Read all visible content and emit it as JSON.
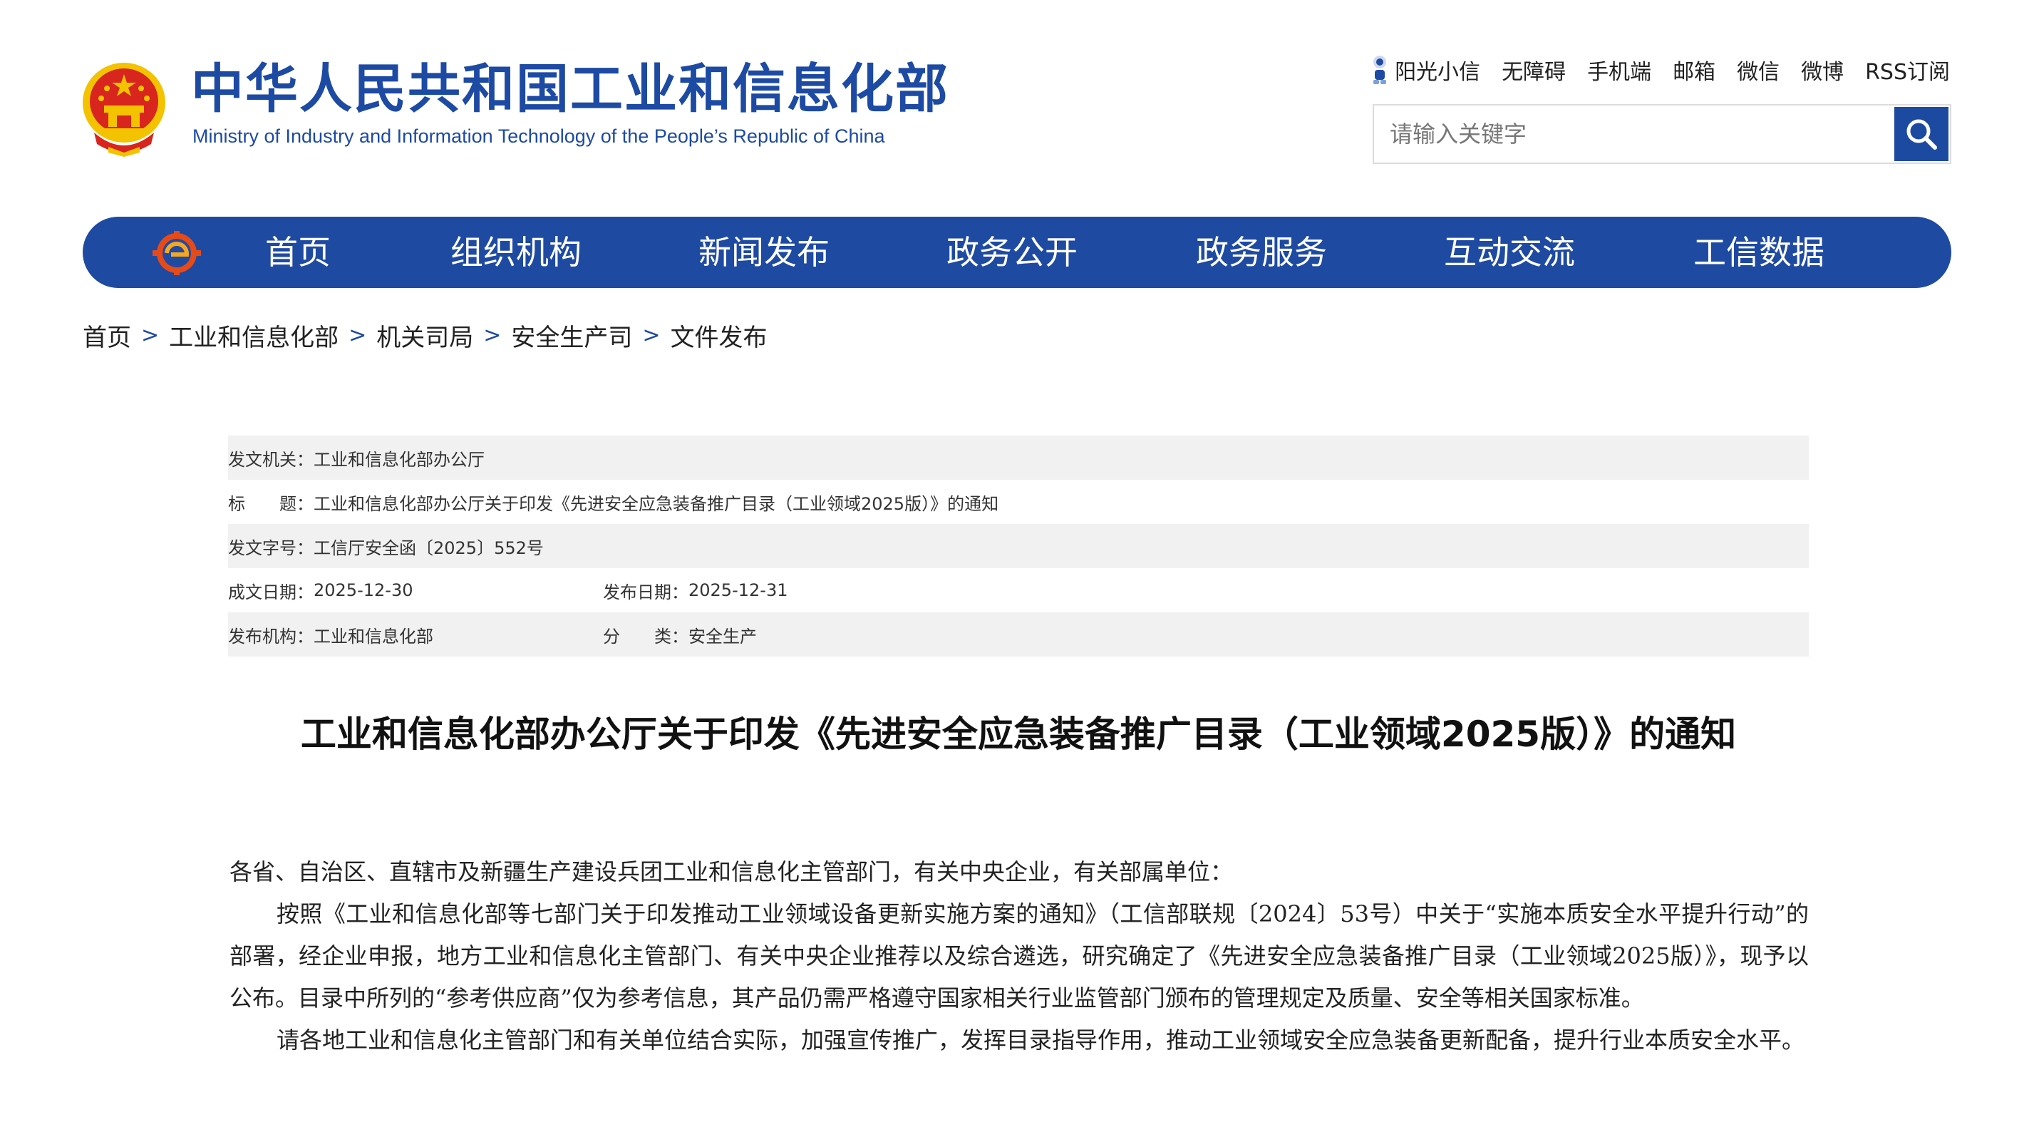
{
  "header": {
    "title": "中华人民共和国工业和信息化部",
    "subtitle": "Ministry of Industry and Information Technology of the People’s Republic of China",
    "top_links": [
      "阳光小信",
      "无障碍",
      "手机端",
      "邮箱",
      "微信",
      "微博",
      "RSS订阅"
    ],
    "search_placeholder": "请输入关键字",
    "colors": {
      "brand_blue": "#1e4aa2",
      "emblem_red": "#d8251e",
      "emblem_gold": "#f3c200"
    }
  },
  "nav": {
    "items": [
      "首页",
      "组织机构",
      "新闻发布",
      "政务公开",
      "政务服务",
      "互动交流",
      "工信数据"
    ]
  },
  "breadcrumb": [
    "首页",
    "工业和信息化部",
    "机关司局",
    "安全生产司",
    "文件发布"
  ],
  "breadcrumb_separator": ">",
  "meta": {
    "issuer_label": "发文机关：",
    "issuer": "工业和信息化部办公厅",
    "title_label": "标　　题：",
    "title": "工业和信息化部办公厅关于印发《先进安全应急装备推广目录（工业领域2025版）》的通知",
    "doc_no_label": "发文字号：",
    "doc_no": "工信厅安全函〔2025〕552号",
    "written_date_label": "成文日期：",
    "written_date": "2025-12-30",
    "publish_date_label": "发布日期：",
    "publish_date": "2025-12-31",
    "publisher_label": "发布机构：",
    "publisher": "工业和信息化部",
    "category_label": "分　　类：",
    "category": "安全生产"
  },
  "article": {
    "title": "工业和信息化部办公厅关于印发《先进安全应急装备推广目录（工业领域2025版）》的通知",
    "salutation": "各省、自治区、直辖市及新疆生产建设兵团工业和信息化主管部门，有关中央企业，有关部属单位：",
    "paragraph1": "按照《工业和信息化部等七部门关于印发推动工业领域设备更新实施方案的通知》（工信部联规〔2024〕53号）中关于“实施本质安全水平提升行动”的部署，经企业申报，地方工业和信息化主管部门、有关中央企业推荐以及综合遴选，研究确定了《先进安全应急装备推广目录（工业领域2025版）》，现予以公布。目录中所列的“参考供应商”仅为参考信息，其产品仍需严格遵守国家相关行业监管部门颁布的管理规定及质量、安全等相关国家标准。",
    "paragraph2": "请各地工业和信息化主管部门和有关单位结合实际，加强宣传推广，发挥目录指导作用，推动工业领域安全应急装备更新配备，提升行业本质安全水平。"
  }
}
